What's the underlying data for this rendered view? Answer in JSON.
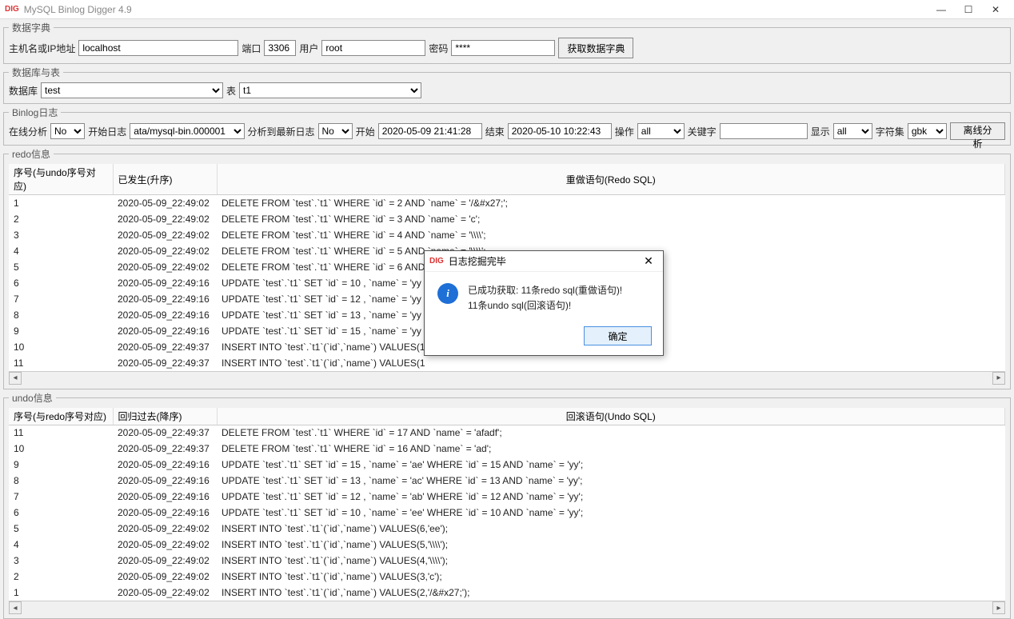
{
  "window": {
    "title": "MySQL Binlog Digger 4.9"
  },
  "dict": {
    "legend": "数据字典",
    "hostLabel": "主机名或IP地址",
    "hostValue": "localhost",
    "portLabel": "端口",
    "portValue": "3306",
    "userLabel": "用户",
    "userValue": "root",
    "passLabel": "密码",
    "passValue": "****",
    "fetchBtn": "获取数据字典"
  },
  "db": {
    "legend": "数据库与表",
    "dbLabel": "数据库",
    "dbValue": "test",
    "tableLabel": "表",
    "tableValue": "t1"
  },
  "binlog": {
    "legend": "Binlog日志",
    "onlineLabel": "在线分析",
    "onlineValue": "No",
    "startLogLabel": "开始日志",
    "startLogValue": "ata/mysql-bin.000001",
    "toLatestLabel": "分析到最新日志",
    "toLatestValue": "No",
    "startLabel": "开始",
    "startValue": "2020-05-09 21:41:28",
    "endLabel": "结束",
    "endValue": "2020-05-10 10:22:43",
    "opLabel": "操作",
    "opValue": "all",
    "kwLabel": "关键字",
    "kwValue": "",
    "showLabel": "显示",
    "showValue": "all",
    "charsetLabel": "字符集",
    "charsetValue": "gbk",
    "offlineBtn": "离线分析"
  },
  "redo": {
    "legend": "redo信息",
    "headers": {
      "seq": "序号(与undo序号对应)",
      "time": "已发生(升序)",
      "sql": "重做语句(Redo SQL)"
    },
    "rows": [
      {
        "seq": "1",
        "time": "2020-05-09_22:49:02",
        "sql": "DELETE FROM `test`.`t1` WHERE `id` = 2 AND `name` = '/&#x27;';"
      },
      {
        "seq": "2",
        "time": "2020-05-09_22:49:02",
        "sql": "DELETE FROM `test`.`t1` WHERE `id` = 3 AND `name` = 'c';"
      },
      {
        "seq": "3",
        "time": "2020-05-09_22:49:02",
        "sql": "DELETE FROM `test`.`t1` WHERE `id` = 4 AND `name` = '\\\\\\\\';"
      },
      {
        "seq": "4",
        "time": "2020-05-09_22:49:02",
        "sql": "DELETE FROM `test`.`t1` WHERE `id` = 5 AND `name` = '\\\\\\\\';"
      },
      {
        "seq": "5",
        "time": "2020-05-09_22:49:02",
        "sql": "DELETE FROM `test`.`t1` WHERE `id` = 6 AND `name` = 'ee';"
      },
      {
        "seq": "6",
        "time": "2020-05-09_22:49:16",
        "sql": "UPDATE `test`.`t1` SET `id` = 10 , `name` = 'yy"
      },
      {
        "seq": "7",
        "time": "2020-05-09_22:49:16",
        "sql": "UPDATE `test`.`t1` SET `id` = 12 , `name` = 'yy"
      },
      {
        "seq": "8",
        "time": "2020-05-09_22:49:16",
        "sql": "UPDATE `test`.`t1` SET `id` = 13 , `name` = 'yy"
      },
      {
        "seq": "9",
        "time": "2020-05-09_22:49:16",
        "sql": "UPDATE `test`.`t1` SET `id` = 15 , `name` = 'yy"
      },
      {
        "seq": "10",
        "time": "2020-05-09_22:49:37",
        "sql": "INSERT INTO `test`.`t1`(`id`,`name`) VALUES(1"
      },
      {
        "seq": "11",
        "time": "2020-05-09_22:49:37",
        "sql": "INSERT INTO `test`.`t1`(`id`,`name`) VALUES(1"
      }
    ]
  },
  "undo": {
    "legend": "undo信息",
    "headers": {
      "seq": "序号(与redo序号对应)",
      "time": "回归过去(降序)",
      "sql": "回滚语句(Undo SQL)"
    },
    "rows": [
      {
        "seq": "11",
        "time": "2020-05-09_22:49:37",
        "sql": "DELETE FROM `test`.`t1` WHERE `id` = 17 AND `name` = 'afadf';"
      },
      {
        "seq": "10",
        "time": "2020-05-09_22:49:37",
        "sql": "DELETE FROM `test`.`t1` WHERE `id` = 16 AND `name` = 'ad';"
      },
      {
        "seq": "9",
        "time": "2020-05-09_22:49:16",
        "sql": "UPDATE `test`.`t1` SET `id` = 15 , `name` = 'ae' WHERE `id` = 15 AND `name` = 'yy';"
      },
      {
        "seq": "8",
        "time": "2020-05-09_22:49:16",
        "sql": "UPDATE `test`.`t1` SET `id` = 13 , `name` = 'ac' WHERE `id` = 13 AND `name` = 'yy';"
      },
      {
        "seq": "7",
        "time": "2020-05-09_22:49:16",
        "sql": "UPDATE `test`.`t1` SET `id` = 12 , `name` = 'ab' WHERE `id` = 12 AND `name` = 'yy';"
      },
      {
        "seq": "6",
        "time": "2020-05-09_22:49:16",
        "sql": "UPDATE `test`.`t1` SET `id` = 10 , `name` = 'ee' WHERE `id` = 10 AND `name` = 'yy';"
      },
      {
        "seq": "5",
        "time": "2020-05-09_22:49:02",
        "sql": "INSERT INTO `test`.`t1`(`id`,`name`) VALUES(6,'ee');"
      },
      {
        "seq": "4",
        "time": "2020-05-09_22:49:02",
        "sql": "INSERT INTO `test`.`t1`(`id`,`name`) VALUES(5,'\\\\\\\\');"
      },
      {
        "seq": "3",
        "time": "2020-05-09_22:49:02",
        "sql": "INSERT INTO `test`.`t1`(`id`,`name`) VALUES(4,'\\\\\\\\');"
      },
      {
        "seq": "2",
        "time": "2020-05-09_22:49:02",
        "sql": "INSERT INTO `test`.`t1`(`id`,`name`) VALUES(3,'c');"
      },
      {
        "seq": "1",
        "time": "2020-05-09_22:49:02",
        "sql": "INSERT INTO `test`.`t1`(`id`,`name`) VALUES(2,'/&#x27;');"
      }
    ]
  },
  "dialog": {
    "title": "日志挖掘完毕",
    "line1": "已成功获取: 11条redo sql(重做语句)!",
    "line2": "11条undo sql(回滚语句)!",
    "ok": "确定"
  }
}
